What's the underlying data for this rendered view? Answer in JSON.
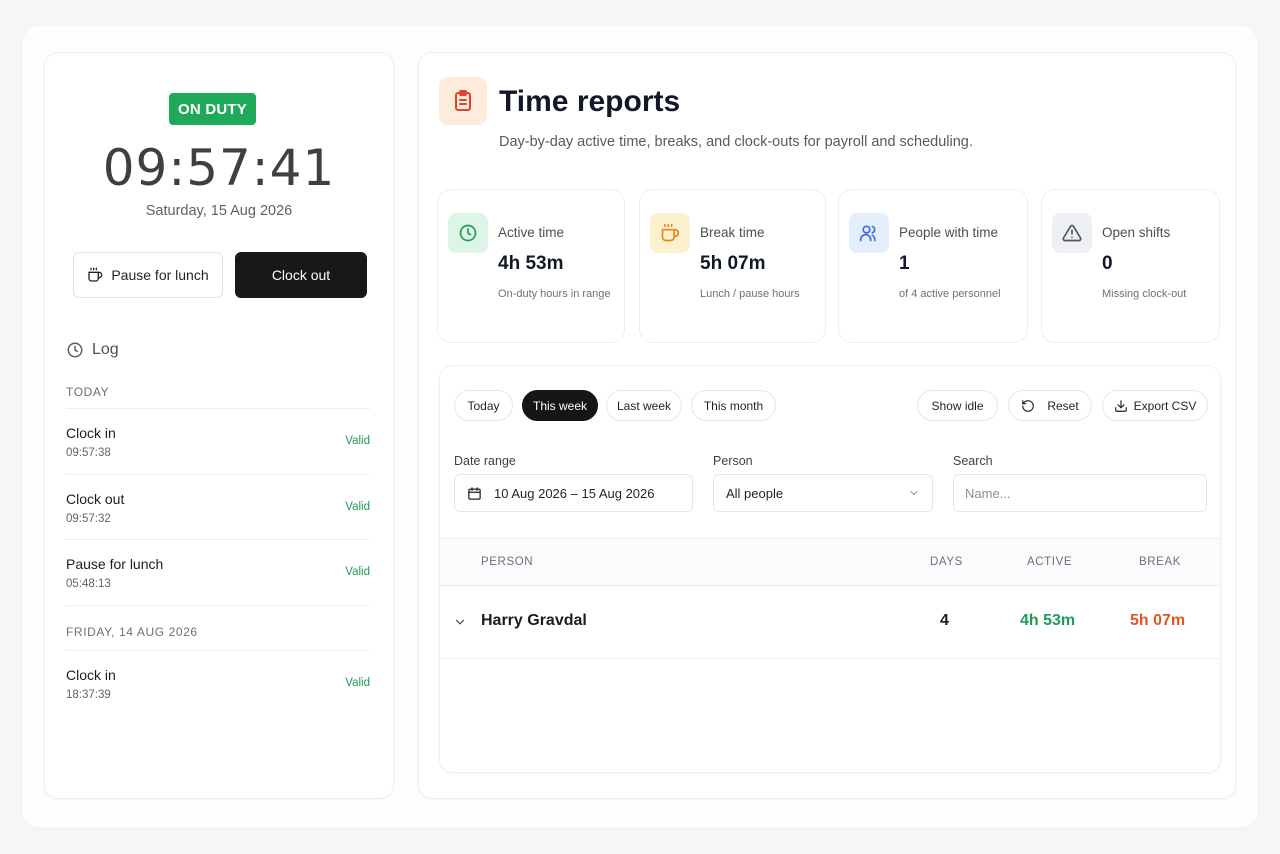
{
  "clock_panel": {
    "status_badge": "ON DUTY",
    "time": "09:57:41",
    "date": "Saturday, 15 Aug 2026",
    "pause_button": "Pause for lunch",
    "clockout_button": "Clock out",
    "log_title": "Log",
    "log_groups": [
      {
        "label": "TODAY",
        "entries": [
          {
            "title": "Clock in",
            "time": "09:57:38",
            "status": "Valid"
          },
          {
            "title": "Clock out",
            "time": "09:57:32",
            "status": "Valid"
          },
          {
            "title": "Pause for lunch",
            "time": "05:48:13",
            "status": "Valid"
          }
        ]
      },
      {
        "label": "FRIDAY, 14 AUG 2026",
        "entries": [
          {
            "title": "Clock in",
            "time": "18:37:39",
            "status": "Valid"
          }
        ]
      }
    ]
  },
  "reports": {
    "title": "Time reports",
    "subtitle": "Day-by-day active time, breaks, and clock-outs for payroll and scheduling.",
    "stats": [
      {
        "label": "Active time",
        "value": "4h 53m",
        "caption": "On-duty hours in range",
        "icon": "clock-icon",
        "color": "#1e9c55"
      },
      {
        "label": "Break time",
        "value": "5h 07m",
        "caption": "Lunch / pause hours",
        "icon": "coffee-icon",
        "color": "#e08a1e"
      },
      {
        "label": "People with time",
        "value": "1",
        "caption": "of 4 active personnel",
        "icon": "users-icon",
        "color": "#3b6fd4"
      },
      {
        "label": "Open shifts",
        "value": "0",
        "caption": "Missing clock-out",
        "icon": "alert-triangle-icon",
        "color": "#4b5563"
      }
    ],
    "range_chips": [
      {
        "label": "Today",
        "active": false
      },
      {
        "label": "This week",
        "active": true
      },
      {
        "label": "Last week",
        "active": false
      },
      {
        "label": "This month",
        "active": false
      }
    ],
    "actions": {
      "show_idle": "Show idle",
      "reset": "Reset",
      "export": "Export CSV"
    },
    "filters": {
      "date_range_label": "Date range",
      "date_range_value": "10 Aug 2026 – 15 Aug 2026",
      "person_label": "Person",
      "person_value": "All people",
      "search_label": "Search",
      "search_placeholder": "Name..."
    },
    "table": {
      "columns": [
        "PERSON",
        "DAYS",
        "ACTIVE",
        "BREAK"
      ],
      "rows": [
        {
          "person": "Harry Gravdal",
          "days": "4",
          "active": "4h 53m",
          "break": "5h 07m"
        }
      ]
    },
    "colors": {
      "active": "#1e9c55",
      "break": "#e0561e",
      "badge": "#1faa5a",
      "title_icon": "#e0442c"
    }
  }
}
